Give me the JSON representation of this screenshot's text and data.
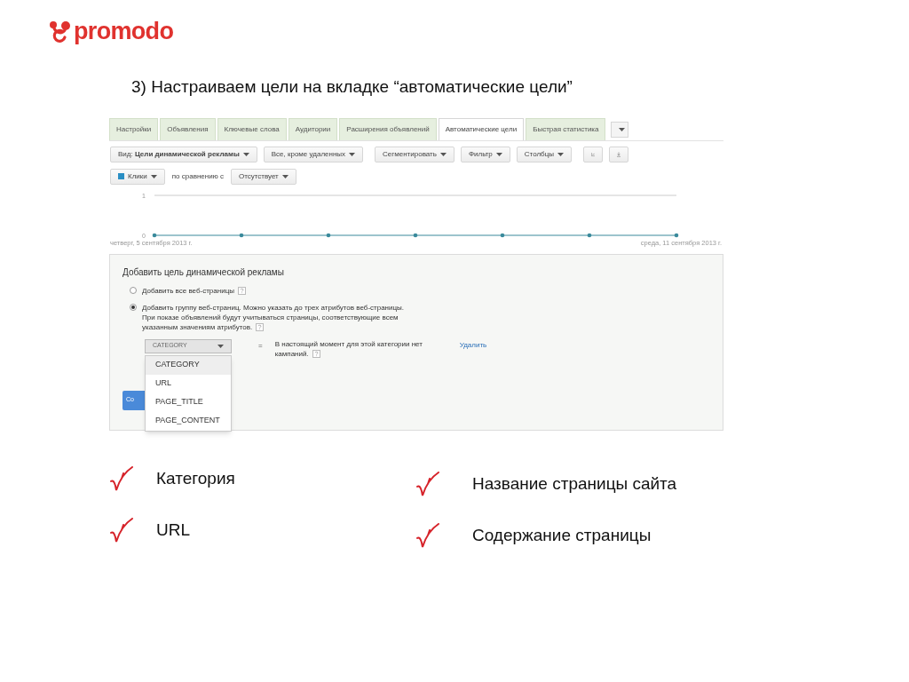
{
  "logo": {
    "text": "promodo"
  },
  "heading": "3) Настраиваем цели на вкладке “автоматические цели”",
  "tabs": [
    {
      "label": "Настройки",
      "selected": false
    },
    {
      "label": "Объявления",
      "selected": false
    },
    {
      "label": "Ключевые слова",
      "selected": false
    },
    {
      "label": "Аудитории",
      "selected": false
    },
    {
      "label": "Расширения объявлений",
      "selected": false
    },
    {
      "label": "Автоматические цели",
      "selected": true
    },
    {
      "label": "Быстрая статистика",
      "selected": false
    }
  ],
  "toolbar": {
    "view": "Вид: **Цели динамической рекламы**",
    "buttons": [
      "Все, кроме удаленных",
      "Сегментировать",
      "Фильтр",
      "Столбцы"
    ]
  },
  "compare": {
    "metric": "Клики",
    "label": "по сравнению с",
    "other": "Отсутствует"
  },
  "chart_data": {
    "type": "line",
    "categories": [
      "четверг, 5 сентября 2013 г.",
      null,
      null,
      null,
      null,
      null,
      "среда, 11 сентября 2013 г."
    ],
    "series": [
      {
        "color": "#3a8a9c",
        "values": [
          0,
          0,
          0,
          0,
          0,
          0,
          0
        ]
      }
    ],
    "ylim": [
      0,
      1
    ],
    "yticks": [
      0,
      1
    ]
  },
  "form": {
    "title": "Добавить цель динамической рекламы",
    "options": [
      {
        "label": "Добавить все веб-страницы",
        "selected": false
      },
      {
        "label": "Добавить группу веб-страниц. Можно указать до трех атрибутов веб-страницы. При показе объявлений будут учитываться страницы, соответствующие всем указанным значениям атрибутов.",
        "selected": true
      }
    ],
    "attribute": {
      "value": "CATEGORY",
      "expanded": true,
      "options": [
        {
          "label": "CATEGORY",
          "selected": true
        },
        {
          "label": "URL",
          "selected": false
        },
        {
          "label": "PAGE_TITLE",
          "selected": false
        },
        {
          "label": "PAGE_CONTENT",
          "selected": false
        }
      ]
    },
    "equals": "=",
    "note": "В настоящий момент для этой категории нет кампаний.",
    "delete": "Удалить",
    "save": "Со"
  },
  "checklist": [
    {
      "text": "Категория"
    },
    {
      "text": "Название страницы сайта"
    },
    {
      "text": "URL"
    },
    {
      "text": "Содержание страницы"
    }
  ]
}
